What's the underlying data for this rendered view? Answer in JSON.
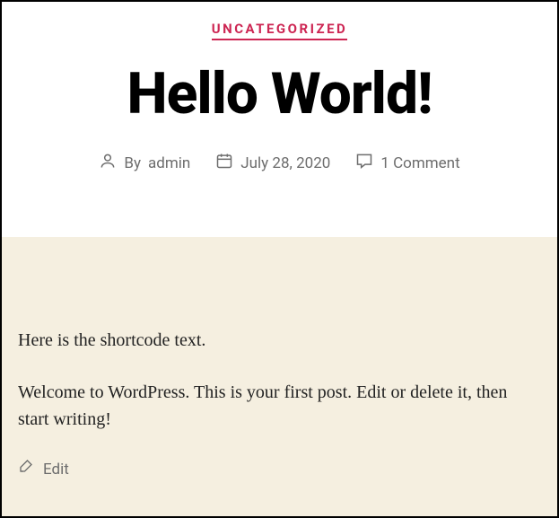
{
  "header": {
    "category": "UNCATEGORIZED",
    "title": "Hello World!",
    "by_label": "By",
    "author": "admin",
    "date": "July 28, 2020",
    "comments": "1 Comment"
  },
  "content": {
    "shortcode_text": "Here is the shortcode text.",
    "body_text": "Welcome to WordPress. This is your first post. Edit or delete it, then start writing!",
    "edit_label": "Edit"
  }
}
